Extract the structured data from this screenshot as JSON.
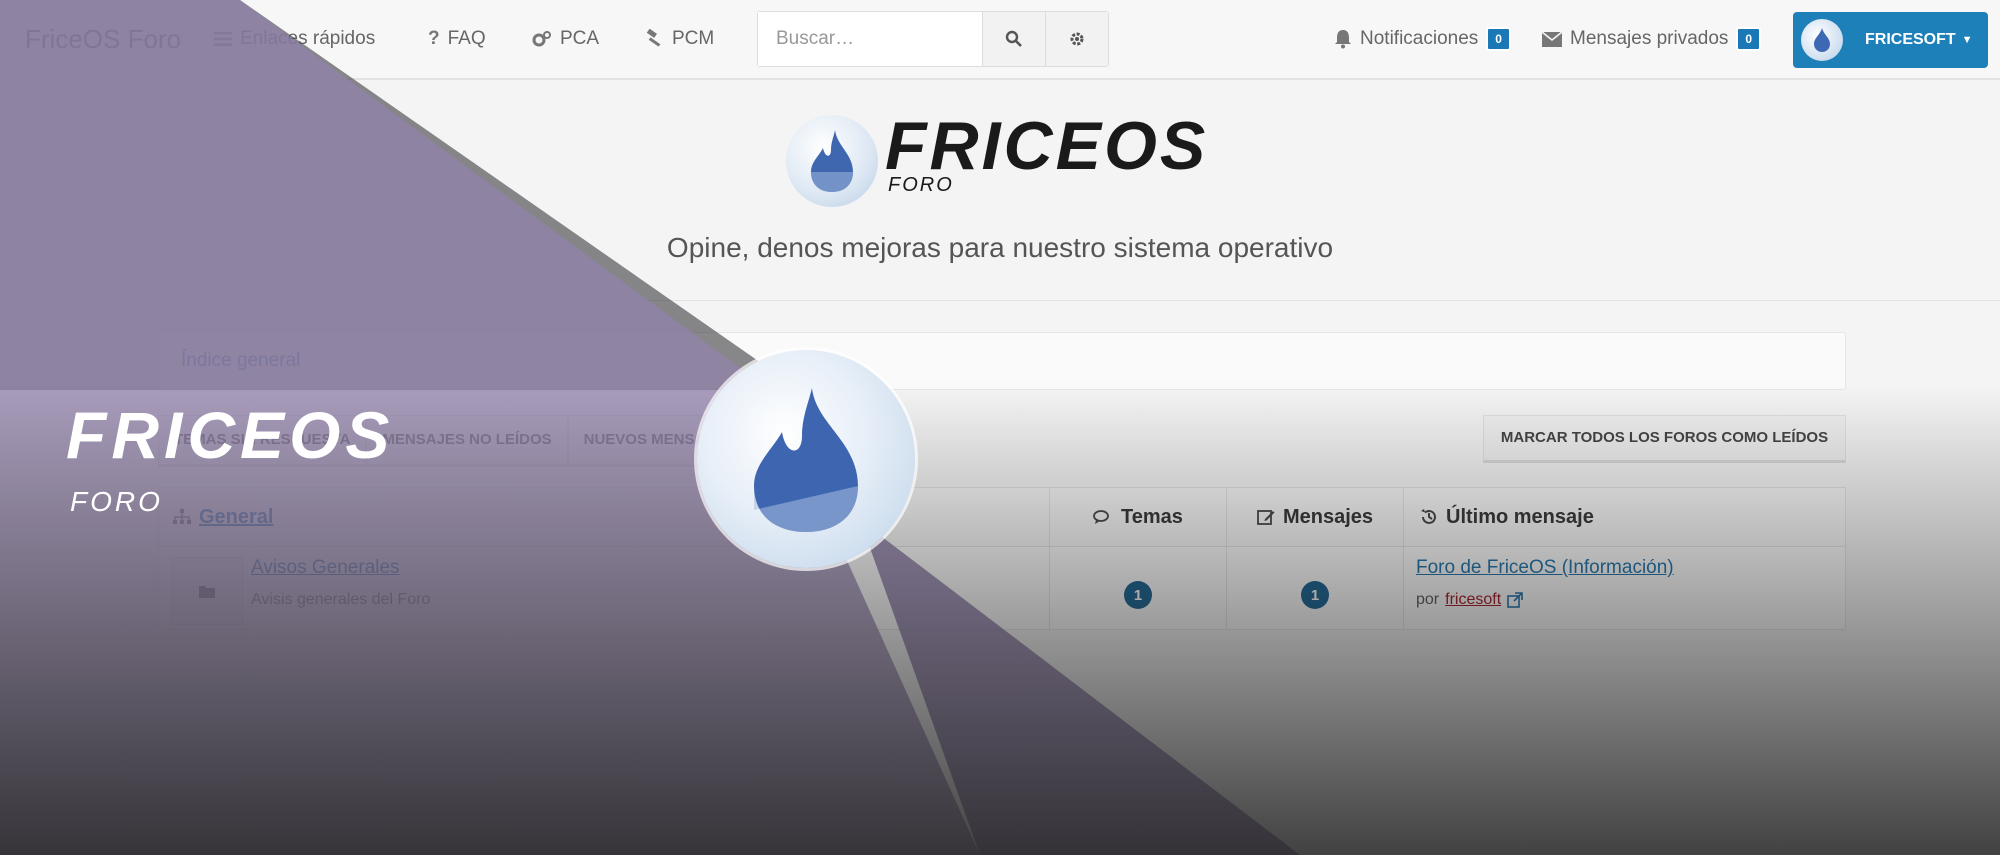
{
  "navbar": {
    "brand": "FriceOS Foro",
    "links": [
      {
        "label": "Enlaces rápidos",
        "icon": "bars-icon"
      },
      {
        "label": "FAQ",
        "icon": "question-icon"
      },
      {
        "label": "PCA",
        "icon": "cogs-icon"
      },
      {
        "label": "PCM",
        "icon": "gavel-icon"
      }
    ],
    "search_placeholder": "Buscar…",
    "notifications": {
      "label": "Notificaciones",
      "count": "0"
    },
    "messages": {
      "label": "Mensajes privados",
      "count": "0"
    },
    "user": "FRICESOFT"
  },
  "header": {
    "logo_word": "FRICEOS",
    "logo_sub": "FORO",
    "tagline": "Opine, denos mejoras para nuestro sistema operativo"
  },
  "breadcrumb": "Índice general",
  "quick_links": [
    "TEMAS SIN RESPUESTA",
    "MENSAJES NO LEÍDOS",
    "NUEVOS MENSAJES"
  ],
  "mark_all": "MARCAR TODOS LOS FOROS COMO LEÍDOS",
  "table": {
    "category": "General",
    "col_topics": "Temas",
    "col_posts": "Mensajes",
    "col_last": "Último mensaje",
    "rows": [
      {
        "title": "Avisos Generales",
        "description": "Avisis generales del Foro",
        "topics": "1",
        "posts": "1",
        "last_title": "Foro de FriceOS (Información)",
        "last_by": "por",
        "last_user": "fricesoft"
      }
    ]
  },
  "banner": {
    "word": "FRICEOS",
    "sub": "FORO"
  },
  "colors": {
    "accent": "#1d80b8",
    "link": "#1d70a8",
    "overlay_purple": "#8a7aa3",
    "overlay_dark": "#555059"
  }
}
